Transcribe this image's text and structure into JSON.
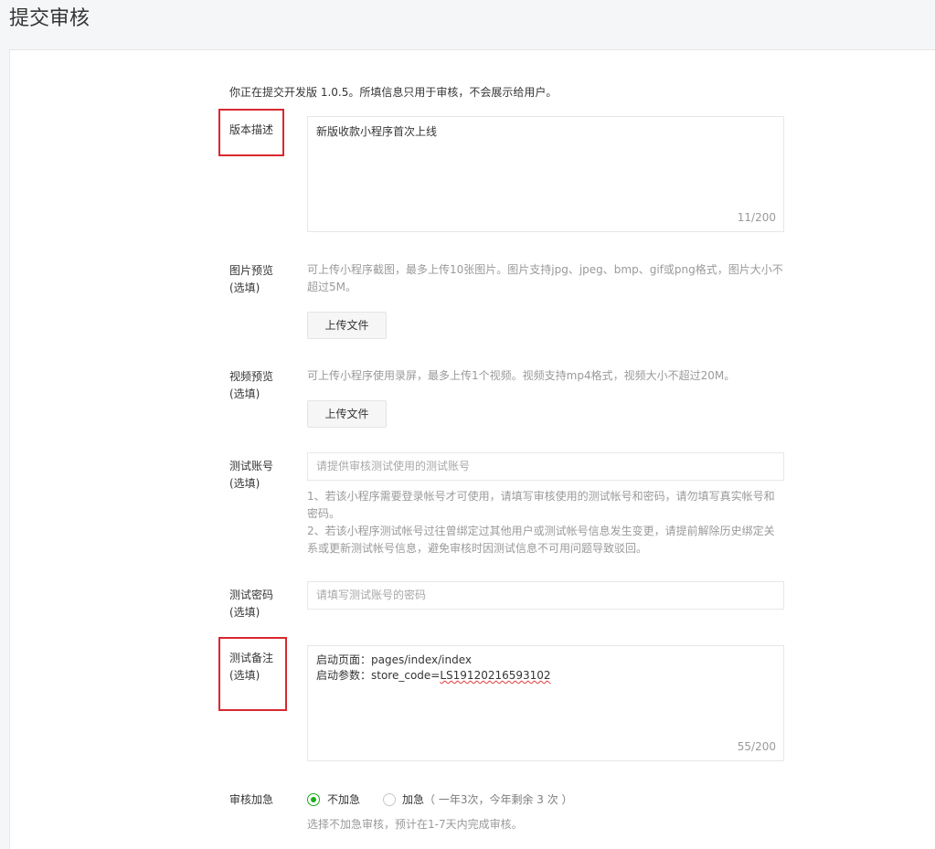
{
  "page": {
    "title": "提交审核"
  },
  "intro": "你正在提交开发版 1.0.5。所填信息只用于审核，不会展示给用户。",
  "version_desc": {
    "label": "版本描述",
    "value": "新版收款小程序首次上线",
    "counter": "11/200"
  },
  "image_preview": {
    "label": "图片预览",
    "optional": "(选填)",
    "hint_line1": "可上传小程序截图，最多上传10张图片。图片支持jpg、jpeg、bmp、gif或png格式，图片大小不",
    "hint_line2": "超过5M。",
    "upload_label": "上传文件"
  },
  "video_preview": {
    "label": "视频预览",
    "optional": "(选填)",
    "hint": "可上传小程序使用录屏，最多上传1个视频。视频支持mp4格式，视频大小不超过20M。",
    "upload_label": "上传文件"
  },
  "test_account": {
    "label": "测试账号",
    "optional": "(选填)",
    "placeholder": "请提供审核测试使用的测试账号",
    "hint_line1": "1、若该小程序需要登录帐号才可使用，请填写审核使用的测试帐号和密码，请勿填写真实帐号和",
    "hint_line2": "密码。",
    "hint_line3": "2、若该小程序测试帐号过往曾绑定过其他用户或测试帐号信息发生变更，请提前解除历史绑定关",
    "hint_line4": "系或更新测试帐号信息，避免审核时因测试信息不可用问题导致驳回。"
  },
  "test_password": {
    "label": "测试密码",
    "optional": "(选填)",
    "placeholder": "请填写测试账号的密码"
  },
  "test_notes": {
    "label": "测试备注",
    "optional": "(选填)",
    "line1": "启动页面：pages/index/index",
    "line2_prefix": "启动参数：store_code=",
    "line2_code": "LS19120216593102",
    "counter": "55/200"
  },
  "expedite": {
    "label": "审核加急",
    "option_normal": "不加急",
    "option_urgent": "加急",
    "urgent_note": "（ 一年3次，今年剩余 3 次 ）",
    "selected": "不加急",
    "hint": "选择不加急审核，预计在1-7天内完成审核。"
  },
  "colors": {
    "accent_green": "#1aad19",
    "highlight_red": "#d9282f"
  }
}
